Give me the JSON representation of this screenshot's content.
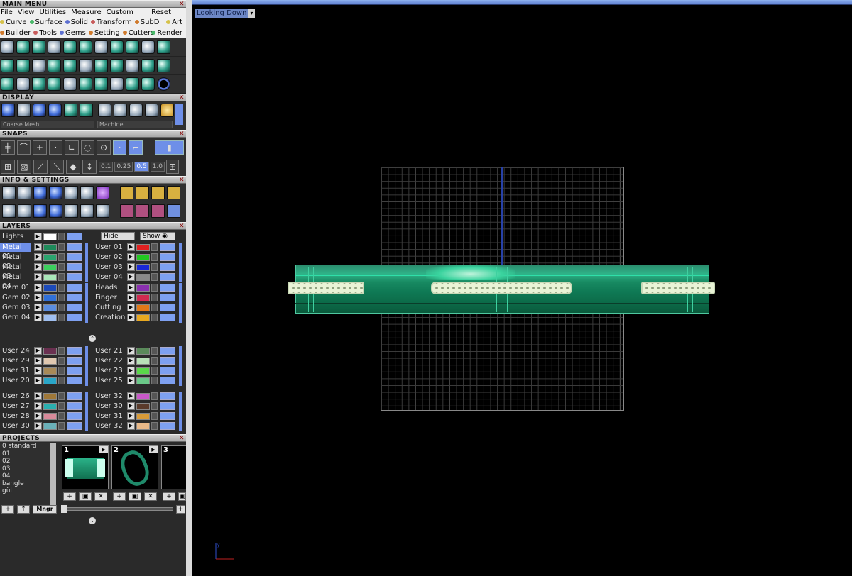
{
  "left_panel": {
    "main_menu_title": "MAIN MENU",
    "menus": [
      "File",
      "View",
      "Utilities",
      "Measure",
      "Custom"
    ],
    "reset": "Reset",
    "categories1": [
      {
        "label": "Curve",
        "color": "#d6c24a"
      },
      {
        "label": "Surface",
        "color": "#4ab86a"
      },
      {
        "label": "Solid",
        "color": "#5c6fd0"
      },
      {
        "label": "Transform",
        "color": "#c85c5c"
      },
      {
        "label": "SubD",
        "color": "#d07a2c"
      },
      {
        "label": "Art",
        "color": "#d6c24a"
      }
    ],
    "categories2": [
      {
        "label": "Builder",
        "color": "#d07a2c"
      },
      {
        "label": "Tools",
        "color": "#c85c5c"
      },
      {
        "label": "Gems",
        "color": "#5c6fd0"
      },
      {
        "label": "Setting",
        "color": "#d07a2c"
      },
      {
        "label": "Cutters",
        "color": "#d07a2c"
      },
      {
        "label": "Render",
        "color": "#4ab86a"
      }
    ],
    "display_title": "DISPLAY",
    "display_mode": "Coarse Mesh",
    "material_mode": "Machine",
    "snaps_title": "SNAPS",
    "snap_values": [
      "0.1",
      "0.25",
      "0.5",
      "1.0"
    ],
    "info_title": "INFO & SETTINGS",
    "layers_title": "LAYERS",
    "lights_label": "Lights",
    "hide_label": "Hide",
    "show_label": "Show",
    "layers_left": [
      {
        "name": "Metal 01",
        "color": "#1e8a5a",
        "selected": true
      },
      {
        "name": "Metal 02",
        "color": "#2aa46e"
      },
      {
        "name": "Metal 03",
        "color": "#3ccf5e"
      },
      {
        "name": "Metal 04",
        "color": "#a8e6b8"
      },
      {
        "name": "Gem 01",
        "color": "#1c4ab8"
      },
      {
        "name": "Gem 02",
        "color": "#3070d8"
      },
      {
        "name": "Gem 03",
        "color": "#5a8de0"
      },
      {
        "name": "Gem 04",
        "color": "#9fbff0"
      },
      {
        "name": "User 24",
        "color": "#6a3050"
      },
      {
        "name": "User 29",
        "color": "#e0c8b0"
      },
      {
        "name": "User 31",
        "color": "#a88a58"
      },
      {
        "name": "User 20",
        "color": "#2aa6c8"
      },
      {
        "name": "User 26",
        "color": "#a07838"
      },
      {
        "name": "User 27",
        "color": "#2ab0b0"
      },
      {
        "name": "User 28",
        "color": "#d88a9a"
      },
      {
        "name": "User 30",
        "color": "#6ab0b8"
      }
    ],
    "layers_right": [
      {
        "name": "User 01",
        "color": "#e02020"
      },
      {
        "name": "User 02",
        "color": "#22c822"
      },
      {
        "name": "User 03",
        "color": "#1a28d8"
      },
      {
        "name": "User 04",
        "color": "#8a8a8a"
      },
      {
        "name": "Heads",
        "color": "#8a30b0"
      },
      {
        "name": "Finger",
        "color": "#d02a50"
      },
      {
        "name": "Cutting",
        "color": "#e07818"
      },
      {
        "name": "Creation",
        "color": "#e8a820"
      },
      {
        "name": "User 21",
        "color": "#5a8a5a"
      },
      {
        "name": "User 22",
        "color": "#b8e0b8"
      },
      {
        "name": "User 23",
        "color": "#5ad84a"
      },
      {
        "name": "User 25",
        "color": "#6ac888"
      },
      {
        "name": "User 32",
        "color": "#c858c8"
      },
      {
        "name": "User 30",
        "color": "#5a3a2a"
      },
      {
        "name": "User 31",
        "color": "#d89a38"
      },
      {
        "name": "User 32",
        "color": "#e8b888"
      }
    ],
    "projects_title": "PROJECTS",
    "projects": [
      "0 standard",
      "01",
      "02",
      "03",
      "04",
      "bangle",
      "gül"
    ],
    "thumb_numbers": [
      "1",
      "2",
      "3"
    ],
    "manager_label": "Mngr"
  },
  "viewport": {
    "view_label": "Looking Down"
  }
}
